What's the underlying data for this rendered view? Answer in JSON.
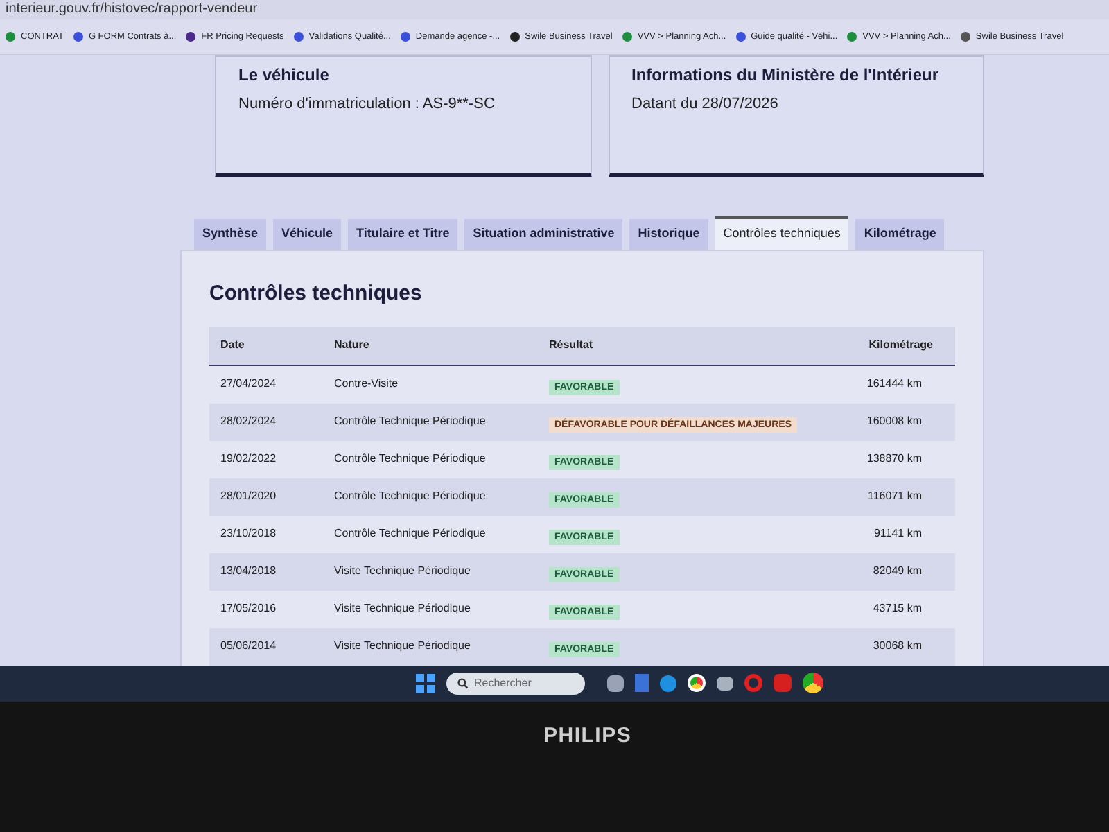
{
  "address_bar": {
    "url": "interieur.gouv.fr/histovec/rapport-vendeur"
  },
  "bookmarks": [
    {
      "label": "CONTRAT",
      "color": "#1e8e3e"
    },
    {
      "label": "G FORM Contrats à...",
      "color": "#3b4fd8"
    },
    {
      "label": "FR Pricing Requests",
      "color": "#4b2a8c"
    },
    {
      "label": "Validations Qualité...",
      "color": "#3b4fd8"
    },
    {
      "label": "Demande agence -...",
      "color": "#3b4fd8"
    },
    {
      "label": "Swile Business Travel",
      "color": "#222222"
    },
    {
      "label": "VVV > Planning Ach...",
      "color": "#1e8e3e"
    },
    {
      "label": "Guide qualité - Véhi...",
      "color": "#3b4fd8"
    },
    {
      "label": "VVV > Planning Ach...",
      "color": "#1e8e3e"
    },
    {
      "label": "Swile Business Travel",
      "color": "#555555"
    }
  ],
  "cards": [
    {
      "title": "Le véhicule",
      "text": "Numéro d'immatriculation : AS-9**-SC"
    },
    {
      "title": "Informations du Ministère de l'Intérieur",
      "text": "Datant du 28/07/2026"
    }
  ],
  "tabs": [
    {
      "label": "Synthèse",
      "selected": false
    },
    {
      "label": "Véhicule",
      "selected": false
    },
    {
      "label": "Titulaire et Titre",
      "selected": false
    },
    {
      "label": "Situation administrative",
      "selected": false
    },
    {
      "label": "Historique",
      "selected": false
    },
    {
      "label": "Contrôles techniques",
      "selected": true
    },
    {
      "label": "Kilométrage",
      "selected": false
    }
  ],
  "section": {
    "title": "Contrôles techniques"
  },
  "table": {
    "columns": [
      "Date",
      "Nature",
      "Résultat",
      "Kilométrage"
    ],
    "rows": [
      {
        "date": "27/04/2024",
        "nature": "Contre-Visite",
        "result": "FAVORABLE",
        "kind": "favorable",
        "mileage": "161444 km"
      },
      {
        "date": "28/02/2024",
        "nature": "Contrôle Technique Périodique",
        "result": "DÉFAVORABLE POUR DÉFAILLANCES MAJEURES",
        "kind": "defavorable",
        "mileage": "160008 km"
      },
      {
        "date": "19/02/2022",
        "nature": "Contrôle Technique Périodique",
        "result": "FAVORABLE",
        "kind": "favorable",
        "mileage": "138870 km"
      },
      {
        "date": "28/01/2020",
        "nature": "Contrôle Technique Périodique",
        "result": "FAVORABLE",
        "kind": "favorable",
        "mileage": "116071 km"
      },
      {
        "date": "23/10/2018",
        "nature": "Contrôle Technique Périodique",
        "result": "FAVORABLE",
        "kind": "favorable",
        "mileage": "91141 km"
      },
      {
        "date": "13/04/2018",
        "nature": "Visite Technique Périodique",
        "result": "FAVORABLE",
        "kind": "favorable",
        "mileage": "82049 km"
      },
      {
        "date": "17/05/2016",
        "nature": "Visite Technique Périodique",
        "result": "FAVORABLE",
        "kind": "favorable",
        "mileage": "43715 km"
      },
      {
        "date": "05/06/2014",
        "nature": "Visite Technique Périodique",
        "result": "FAVORABLE",
        "kind": "favorable",
        "mileage": "30068 km"
      }
    ]
  },
  "taskbar": {
    "search": {
      "placeholder": "Rechercher"
    }
  },
  "monitor": {
    "brand": "PHILIPS"
  }
}
